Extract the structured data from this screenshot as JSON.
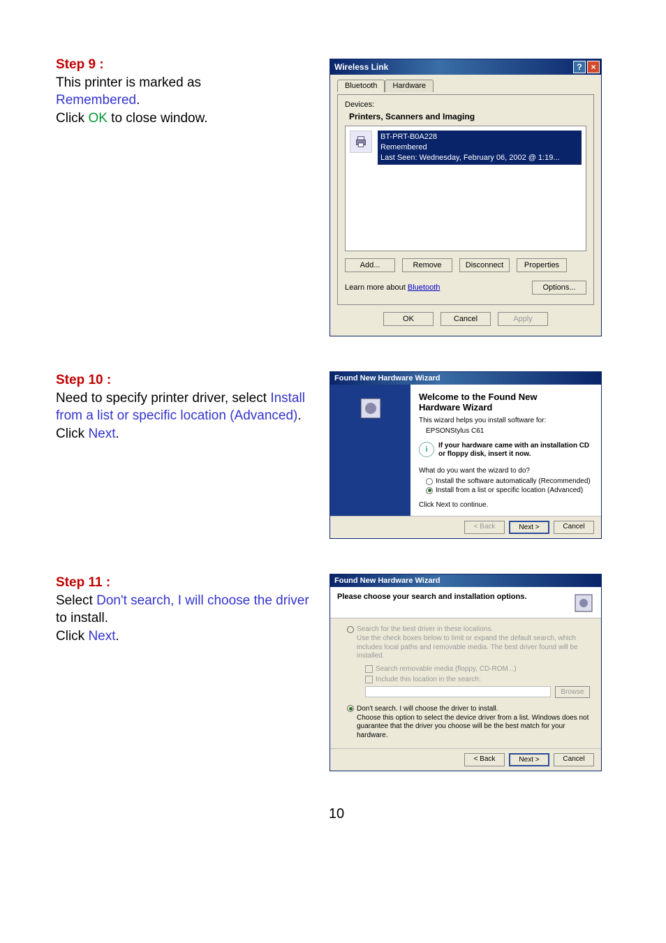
{
  "step9": {
    "title": "Step 9 :",
    "line1": "This printer is marked as ",
    "remembered": "Remembered",
    "period1": ".",
    "line2a": "Click ",
    "ok": "OK",
    "line2b": " to close window."
  },
  "wl": {
    "title": "Wireless Link",
    "tab_bluetooth": "Bluetooth",
    "tab_hardware": "Hardware",
    "devices_label": "Devices:",
    "category": "Printers, Scanners and Imaging",
    "device": {
      "name": "BT-PRT-B0A228",
      "status": "Remembered",
      "last_seen": "Last Seen: Wednesday, February 06, 2002 @ 1:19..."
    },
    "btn_add": "Add...",
    "btn_remove": "Remove",
    "btn_disconnect": "Disconnect",
    "btn_properties": "Properties",
    "learn_text": "Learn more about ",
    "learn_link": "Bluetooth",
    "btn_options": "Options...",
    "btn_ok": "OK",
    "btn_cancel": "Cancel",
    "btn_apply": "Apply"
  },
  "step10": {
    "title": "Step 10 :",
    "line1": "Need to specify printer driver, select ",
    "hl": "Install from a list or specific location (Advanced)",
    "period": ".",
    "line2a": "Click ",
    "next": "Next",
    "line2b": "."
  },
  "wiz1": {
    "title": "Found New Hardware Wizard",
    "heading": "Welcome to the Found New\nHardware Wizard",
    "helps": "This wizard helps you install software for:",
    "device": "EPSONStylus C61",
    "note": "If your hardware came with an installation CD or floppy disk, insert it now.",
    "question": "What do you want the wizard to do?",
    "opt_auto": "Install the software automatically (Recommended)",
    "opt_list": "Install from a list or specific location (Advanced)",
    "cont": "Click Next to continue.",
    "btn_back": "< Back",
    "btn_next": "Next >",
    "btn_cancel": "Cancel"
  },
  "step11": {
    "title": "Step 11 :",
    "line1a": "Select ",
    "hl": "Don't search, I will choose the driver",
    "line1b": " to install.",
    "line2a": "Click ",
    "next": "Next",
    "line2b": "."
  },
  "wiz2": {
    "title": "Found New Hardware Wizard",
    "heading": "Please choose your search and installation options.",
    "opt_search": "Search for the best driver in these locations.",
    "search_desc": "Use the check boxes below to limit or expand the default search, which includes local paths and removable media. The best driver found will be installed.",
    "chk_removable": "Search removable media (floppy, CD-ROM...)",
    "chk_include": "Include this location in the search:",
    "btn_browse": "Browse",
    "opt_dont": "Don't search. I will choose the driver to install.",
    "dont_desc": "Choose this option to select the device driver from a list.  Windows does not guarantee that the driver you choose will be the best match for your hardware.",
    "btn_back": "< Back",
    "btn_next": "Next >",
    "btn_cancel": "Cancel"
  },
  "page_number": "10"
}
